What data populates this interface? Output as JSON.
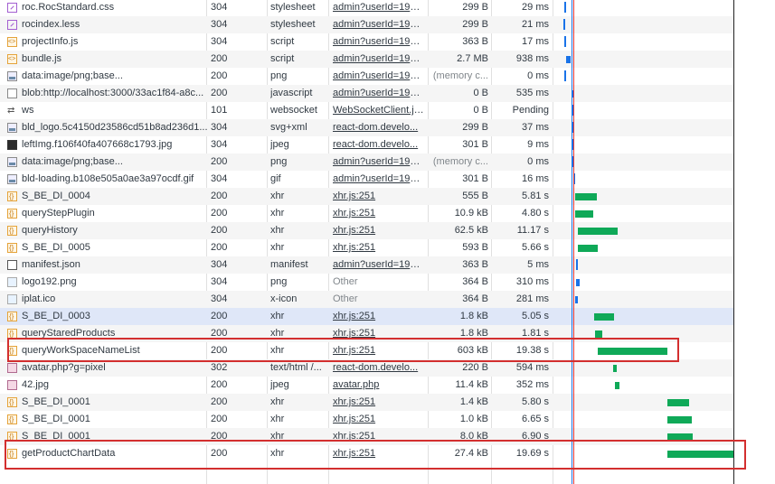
{
  "colors": {
    "bar_green": "#0fa958",
    "bar_blue": "#1a73e8",
    "selection": "#dfe7f8",
    "highlight_box": "#d32f2f"
  },
  "rows": [
    {
      "name": "roc.RocStandard.css",
      "icon": "css-icon",
      "status": "304",
      "type": "stylesheet",
      "initiator": "admin?userId=1950...",
      "init_link": true,
      "size": "299 B",
      "time": "29 ms"
    },
    {
      "name": "rocindex.less",
      "icon": "css-icon",
      "status": "304",
      "type": "stylesheet",
      "initiator": "admin?userId=1950...",
      "init_link": true,
      "size": "299 B",
      "time": "21 ms"
    },
    {
      "name": "projectInfo.js",
      "icon": "js-icon",
      "status": "304",
      "type": "script",
      "initiator": "admin?userId=1950...",
      "init_link": true,
      "size": "363 B",
      "time": "17 ms"
    },
    {
      "name": "bundle.js",
      "icon": "js-icon",
      "status": "200",
      "type": "script",
      "initiator": "admin?userId=1950...",
      "init_link": true,
      "size": "2.7 MB",
      "time": "938 ms"
    },
    {
      "name": "data:image/png;base...",
      "icon": "image-icon",
      "status": "200",
      "type": "png",
      "initiator": "admin?userId=1950...",
      "init_link": true,
      "size": "(memory c...",
      "time": "0 ms"
    },
    {
      "name": "blob:http://localhost:3000/33ac1f84-a8c...",
      "icon": "document-icon",
      "status": "200",
      "type": "javascript",
      "initiator": "admin?userId=1950...",
      "init_link": true,
      "size": "0 B",
      "time": "535 ms"
    },
    {
      "name": "ws",
      "icon": "websocket-icon",
      "status": "101",
      "type": "websocket",
      "initiator": "WebSocketClient.js:...",
      "init_link": true,
      "size": "0 B",
      "time": "Pending"
    },
    {
      "name": "bld_logo.5c4150d23586cd51b8ad236d1...",
      "icon": "image-icon",
      "status": "304",
      "type": "svg+xml",
      "initiator": "react-dom.develo...",
      "init_link": true,
      "size": "299 B",
      "time": "37 ms"
    },
    {
      "name": "leftImg.f106f40fa407668c1793.jpg",
      "icon": "dark-image-icon",
      "status": "304",
      "type": "jpeg",
      "initiator": "react-dom.develo...",
      "init_link": true,
      "size": "301 B",
      "time": "9 ms"
    },
    {
      "name": "data:image/png;base...",
      "icon": "image-icon",
      "status": "200",
      "type": "png",
      "initiator": "admin?userId=1950...",
      "init_link": true,
      "size": "(memory c...",
      "time": "0 ms"
    },
    {
      "name": "bld-loading.b108e505a0ae3a97ocdf.gif",
      "icon": "image-icon",
      "status": "304",
      "type": "gif",
      "initiator": "admin?userId=1950...",
      "init_link": true,
      "size": "301 B",
      "time": "16 ms"
    },
    {
      "name": "S_BE_DI_0004",
      "icon": "xhr-icon",
      "status": "200",
      "type": "xhr",
      "initiator": "xhr.js:251",
      "init_link": true,
      "size": "555 B",
      "time": "5.81 s"
    },
    {
      "name": "queryStepPlugin",
      "icon": "xhr-icon",
      "status": "200",
      "type": "xhr",
      "initiator": "xhr.js:251",
      "init_link": true,
      "size": "10.9 kB",
      "time": "4.80 s"
    },
    {
      "name": "queryHistory",
      "icon": "xhr-icon",
      "status": "200",
      "type": "xhr",
      "initiator": "xhr.js:251",
      "init_link": true,
      "size": "62.5 kB",
      "time": "11.17 s"
    },
    {
      "name": "S_BE_DI_0005",
      "icon": "xhr-icon",
      "status": "200",
      "type": "xhr",
      "initiator": "xhr.js:251",
      "init_link": true,
      "size": "593 B",
      "time": "5.66 s"
    },
    {
      "name": "manifest.json",
      "icon": "manifest-icon",
      "status": "304",
      "type": "manifest",
      "initiator": "admin?userId=1950...",
      "init_link": true,
      "size": "363 B",
      "time": "5 ms"
    },
    {
      "name": "logo192.png",
      "icon": "logo-icon",
      "status": "304",
      "type": "png",
      "initiator": "Other",
      "init_link": false,
      "size": "364 B",
      "time": "310 ms"
    },
    {
      "name": "iplat.ico",
      "icon": "logo-icon",
      "status": "304",
      "type": "x-icon",
      "initiator": "Other",
      "init_link": false,
      "size": "364 B",
      "time": "281 ms"
    },
    {
      "name": "S_BE_DI_0003",
      "icon": "xhr-icon",
      "status": "200",
      "type": "xhr",
      "initiator": "xhr.js:251",
      "init_link": true,
      "size": "1.8 kB",
      "time": "5.05 s"
    },
    {
      "name": "queryStaredProducts",
      "icon": "xhr-icon",
      "status": "200",
      "type": "xhr",
      "initiator": "xhr.js:251",
      "init_link": true,
      "size": "1.8 kB",
      "time": "1.81 s"
    },
    {
      "name": "queryWorkSpaceNameList",
      "icon": "xhr-icon",
      "status": "200",
      "type": "xhr",
      "initiator": "xhr.js:251",
      "init_link": true,
      "size": "603 kB",
      "time": "19.38 s"
    },
    {
      "name": "avatar.php?g=pixel",
      "icon": "avatar-icon",
      "status": "302",
      "type": "text/html /...",
      "initiator": "react-dom.develo...",
      "init_link": true,
      "size": "220 B",
      "time": "594 ms"
    },
    {
      "name": "42.jpg",
      "icon": "avatar-icon",
      "status": "200",
      "type": "jpeg",
      "initiator": "avatar.php",
      "init_link": true,
      "size": "11.4 kB",
      "time": "352 ms"
    },
    {
      "name": "S_BE_DI_0001",
      "icon": "xhr-icon",
      "status": "200",
      "type": "xhr",
      "initiator": "xhr.js:251",
      "init_link": true,
      "size": "1.4 kB",
      "time": "5.80 s"
    },
    {
      "name": "S_BE_DI_0001",
      "icon": "xhr-icon",
      "status": "200",
      "type": "xhr",
      "initiator": "xhr.js:251",
      "init_link": true,
      "size": "1.0 kB",
      "time": "6.65 s"
    },
    {
      "name": "S_BE_DI_0001",
      "icon": "xhr-icon",
      "status": "200",
      "type": "xhr",
      "initiator": "xhr.js:251",
      "init_link": true,
      "size": "8.0 kB",
      "time": "6.90 s"
    },
    {
      "name": "getProductChartData",
      "icon": "xhr-icon",
      "status": "200",
      "type": "xhr",
      "initiator": "xhr.js:251",
      "init_link": true,
      "size": "27.4 kB",
      "time": "19.69 s"
    }
  ]
}
